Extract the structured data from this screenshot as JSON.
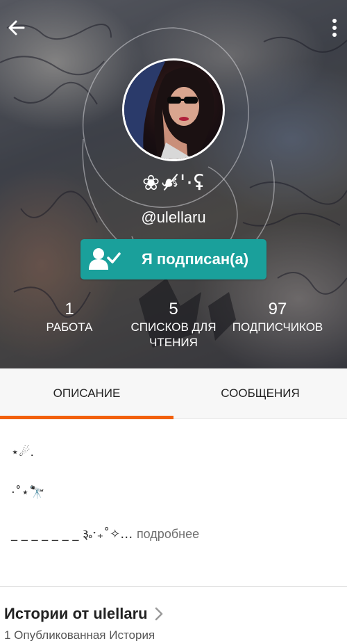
{
  "header": {
    "display_name": "❀☙̸'·ʢ",
    "username": "@ulellaru",
    "follow_label": "Я подписан(а)",
    "icons": {
      "back": "arrow-left-icon",
      "more": "more-vert-icon",
      "follow": "user-check-icon"
    }
  },
  "stats": [
    {
      "value": "1",
      "label": "РАБОТА"
    },
    {
      "value": "5",
      "label": "СПИСКОВ ДЛЯ ЧТЕНИЯ"
    },
    {
      "value": "97",
      "label": "ПОДПИСЧИКОВ"
    }
  ],
  "tabs": [
    {
      "label": "ОПИСАНИЕ",
      "active": true
    },
    {
      "label": "СООБЩЕНИЯ",
      "active": false
    }
  ],
  "description": {
    "line1": "⋆☄.",
    "line2": "·˚⋆🔭",
    "line3": "_ _ _ _ _ _ _ ૱ˑ₊˚✧…",
    "more_link": "подробнее"
  },
  "stories": {
    "title": "Истории от ulellaru",
    "subtitle": "1 Опубликованная История"
  },
  "colors": {
    "accent": "#f2600c",
    "follow_button": "#1aa09b"
  }
}
